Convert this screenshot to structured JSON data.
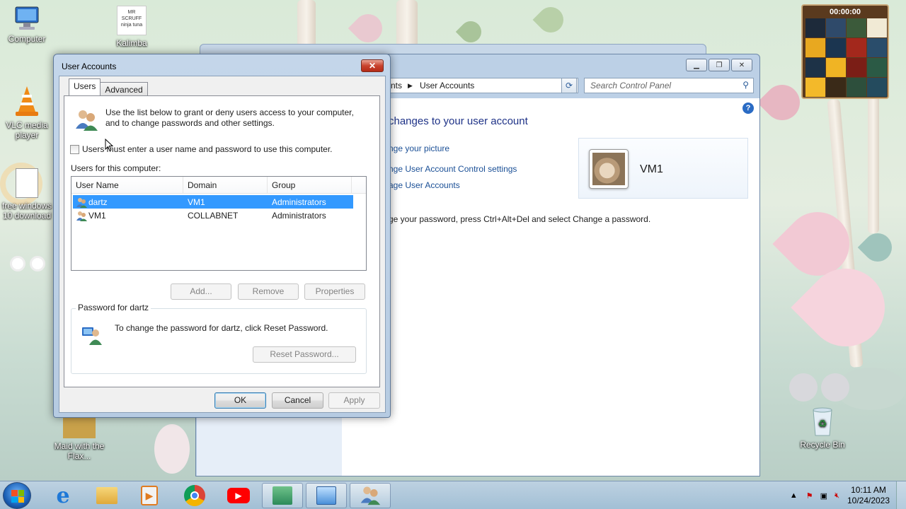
{
  "desktop": {
    "icons": [
      {
        "label": "Computer"
      },
      {
        "label": "Kalimba"
      },
      {
        "label": "VLC media player"
      },
      {
        "label": "free windows 10 download"
      },
      {
        "label": "Maid with the Flax..."
      },
      {
        "label": "Recycle Bin"
      }
    ],
    "kalimba_art_text": "MR SCRUFF ninja tuna"
  },
  "control_panel": {
    "breadcrumb_tail": "nts",
    "breadcrumb_current": "User Accounts",
    "search_placeholder": "Search Control Panel",
    "heading": "changes to your user account",
    "links": [
      "nge your picture",
      "nge User Account Control settings",
      "age User Accounts"
    ],
    "password_note": "ge your password, press Ctrl+Alt+Del and select Change a password.",
    "account_name": "VM1"
  },
  "dialog": {
    "title": "User Accounts",
    "tabs": [
      "Users",
      "Advanced"
    ],
    "intro": "Use the list below to grant or deny users access to your computer, and to change passwords and other settings.",
    "checkbox_label": "Users must enter a user name and password to use this computer.",
    "checkbox_checked": false,
    "users_label": "Users for this computer:",
    "columns": [
      "User Name",
      "Domain",
      "Group"
    ],
    "rows": [
      {
        "name": "dartz",
        "domain": "VM1",
        "group": "Administrators",
        "selected": true
      },
      {
        "name": "VM1",
        "domain": "COLLABNET",
        "group": "Administrators",
        "selected": false
      }
    ],
    "buttons": {
      "add": "Add...",
      "remove": "Remove",
      "properties": "Properties"
    },
    "password_group_title": "Password for dartz",
    "password_text": "To change the password for dartz, click Reset Password.",
    "reset_button": "Reset Password...",
    "ok": "OK",
    "cancel": "Cancel",
    "apply": "Apply"
  },
  "clock_widget": {
    "time": "00:00:00"
  },
  "taskbar": {
    "apps": [
      "internet-explorer",
      "file-explorer",
      "media-player",
      "chrome",
      "youtube",
      "app-installer",
      "control-panel",
      "user-accounts"
    ],
    "time": "10:11 AM",
    "date": "10/24/2023"
  }
}
